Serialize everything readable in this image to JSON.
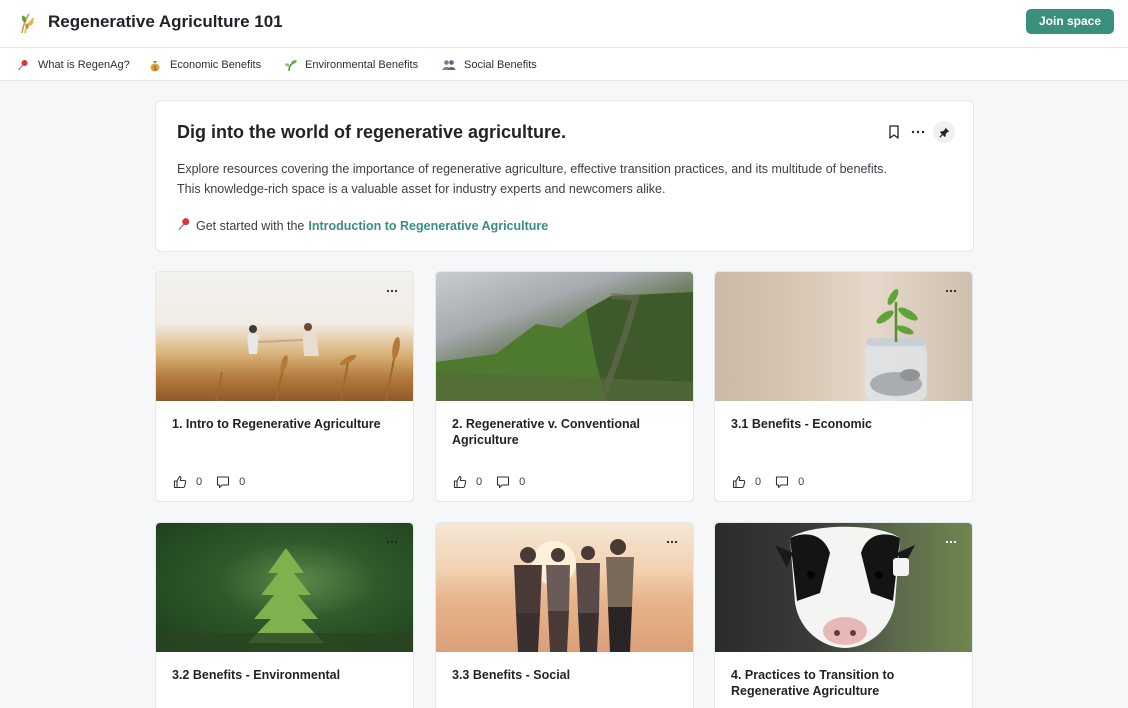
{
  "header": {
    "title": "Regenerative Agriculture 101",
    "join_label": "Join space"
  },
  "nav": [
    {
      "icon": "pushpin-icon",
      "label": "What is RegenAg?"
    },
    {
      "icon": "money-bag-icon",
      "label": "Economic Benefits"
    },
    {
      "icon": "seedling-icon",
      "label": "Environmental Benefits"
    },
    {
      "icon": "people-icon",
      "label": "Social Benefits"
    }
  ],
  "hero": {
    "title": "Dig into the world of regenerative agriculture.",
    "description_line1": "Explore resources covering the importance of regenerative agriculture, effective transition practices, and its multitude of benefits.",
    "description_line2": "This knowledge-rich space is a valuable asset for industry experts and newcomers alike.",
    "cta_prefix": "Get started with the",
    "cta_link": "Introduction to Regenerative Agriculture"
  },
  "cards": [
    {
      "title": "1. Intro to Regenerative Agriculture",
      "likes": "0",
      "comments": "0",
      "image": "wheat-field-handshake"
    },
    {
      "title": "2. Regenerative v. Conventional Agriculture",
      "likes": "0",
      "comments": "0",
      "image": "green-cliffs"
    },
    {
      "title": "3.1 Benefits - Economic",
      "likes": "0",
      "comments": "0",
      "image": "plant-in-coin-jar"
    },
    {
      "title": "3.2 Benefits - Environmental",
      "image": "forest-seedling"
    },
    {
      "title": "3.3 Benefits - Social",
      "image": "group-of-friends"
    },
    {
      "title": "4. Practices to Transition to Regenerative Agriculture",
      "image": "dairy-cow"
    }
  ],
  "colors": {
    "accent": "#3b8f7f",
    "background": "#f6f7f9",
    "border": "#e4e6ea"
  }
}
